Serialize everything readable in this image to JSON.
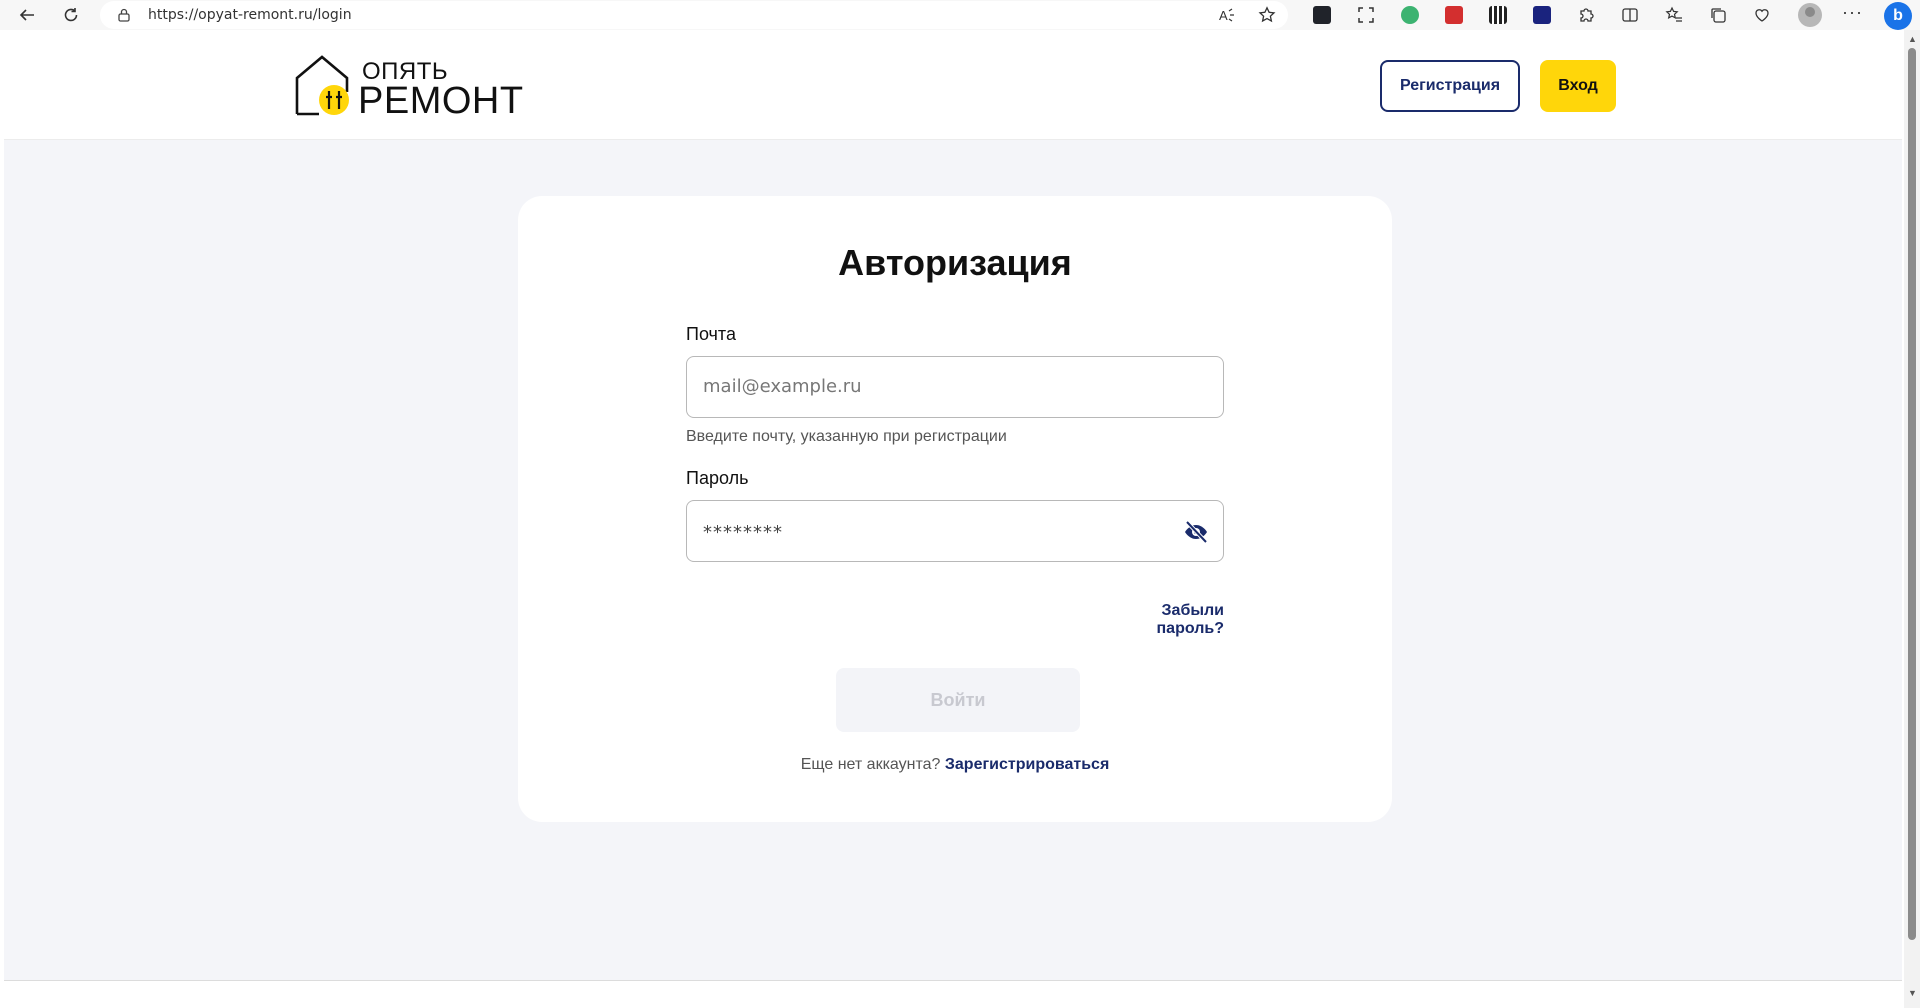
{
  "browser": {
    "url": "https://opyat-remont.ru/login",
    "more_label": "···",
    "extensions": [
      {
        "name": "react-devtools-icon",
        "color": "#20232a"
      },
      {
        "name": "screenshot-icon",
        "color": "#333333"
      },
      {
        "name": "extension-green-icon",
        "color": "#3cb371"
      },
      {
        "name": "extension-red-icon",
        "color": "#d32f2f"
      },
      {
        "name": "extension-grid-icon",
        "color": "#222222"
      },
      {
        "name": "extension-dark-icon",
        "color": "#1a237e"
      },
      {
        "name": "extensions-puzzle-icon",
        "color": "#333333"
      },
      {
        "name": "split-screen-icon",
        "color": "#333333"
      },
      {
        "name": "favorites-icon",
        "color": "#333333"
      },
      {
        "name": "collections-icon",
        "color": "#333333"
      },
      {
        "name": "performance-icon",
        "color": "#333333"
      }
    ]
  },
  "header": {
    "logo_top": "ОПЯТЬ",
    "logo_bottom": "РЕМОНТ",
    "register_label": "Регистрация",
    "login_label": "Вход"
  },
  "form": {
    "title": "Авторизация",
    "email_label": "Почта",
    "email_placeholder": "mail@example.ru",
    "email_hint": "Введите почту, указанную при регистрации",
    "password_label": "Пароль",
    "password_value": "********",
    "forgot_label": "Забыли пароль?",
    "submit_label": "Войти",
    "no_account_text": "Еще нет аккаунта?",
    "signup_link": "Зарегистрироваться"
  },
  "colors": {
    "accent_yellow": "#ffd60a",
    "brand_navy": "#1a2b6b",
    "page_bg": "#f4f5f9"
  }
}
